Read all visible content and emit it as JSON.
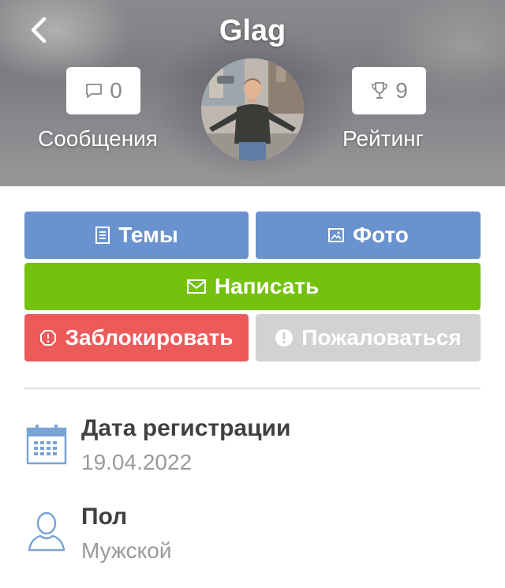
{
  "header": {
    "title": "Glag",
    "messages": {
      "count": "0",
      "label": "Сообщения",
      "icon": "comment-icon"
    },
    "rating": {
      "count": "9",
      "label": "Рейтинг",
      "icon": "trophy-icon"
    }
  },
  "actions": {
    "topics": "Темы",
    "photo": "Фото",
    "write": "Написать",
    "block": "Заблокировать",
    "report": "Пожаловаться"
  },
  "colors": {
    "primary_blue": "#6992cf",
    "green": "#74c20e",
    "red": "#ec5a5a",
    "gray": "#d2d2d2"
  },
  "info": [
    {
      "label": "Дата регистрации",
      "value": "19.04.2022",
      "icon": "calendar-icon"
    },
    {
      "label": "Пол",
      "value": "Мужской",
      "icon": "user-icon"
    }
  ]
}
